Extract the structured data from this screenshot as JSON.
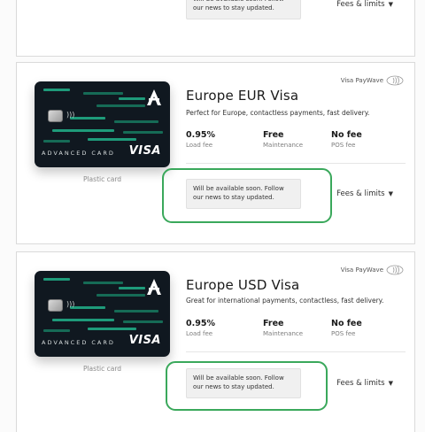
{
  "cards": [
    {
      "id": "top-partial",
      "notice": "Will be available soon. Follow our news to stay updated.",
      "fees_label": "Fees & limits"
    },
    {
      "id": "eur",
      "paywave": "Visa PayWave",
      "title": "Europe EUR Visa",
      "description": "Perfect for Europe, contactless payments, fast delivery.",
      "card_brand": "ADVANCED CARD",
      "card_network": "VISA",
      "card_type": "Plastic card",
      "stats": [
        {
          "value": "0.95%",
          "label": "Load fee"
        },
        {
          "value": "Free",
          "label": "Maintenance"
        },
        {
          "value": "No fee",
          "label": "POS fee"
        }
      ],
      "notice": "Will be available soon. Follow our news to stay updated.",
      "fees_label": "Fees & limits"
    },
    {
      "id": "usd",
      "paywave": "Visa PayWave",
      "title": "Europe USD Visa",
      "description": "Great for international payments, contactless, fast delivery.",
      "card_brand": "ADVANCED CARD",
      "card_network": "VISA",
      "card_type": "Plastic card",
      "stats": [
        {
          "value": "0.95%",
          "label": "Load fee"
        },
        {
          "value": "Free",
          "label": "Maintenance"
        },
        {
          "value": "No fee",
          "label": "POS fee"
        }
      ],
      "notice": "Will be available soon. Follow our news to stay updated.",
      "fees_label": "Fees & limits"
    }
  ],
  "icons": {
    "fees_caret": "caret-down-icon",
    "paywave": "contactless-icon",
    "card_logo": "advanced-cash-logo-icon"
  },
  "colors": {
    "highlight": "#3aa85b",
    "card_bg": "#101820",
    "card_stripe": "#1e9b7a"
  }
}
